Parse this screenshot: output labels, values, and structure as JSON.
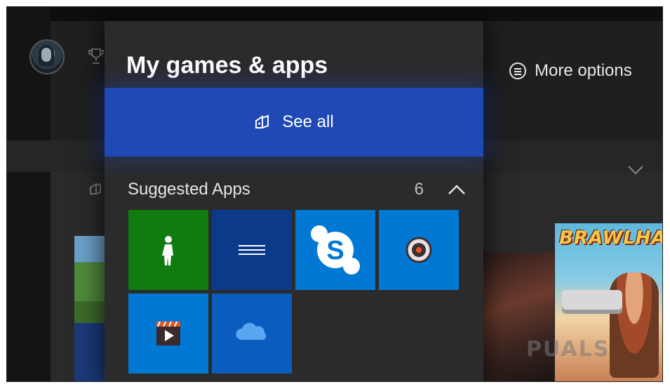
{
  "guide": {
    "title": "My games & apps",
    "see_all": {
      "label": "See all",
      "icon": "my-games-icon"
    },
    "section": {
      "label": "Suggested Apps",
      "count": "6",
      "toggle_icon": "chevron-up-icon"
    },
    "tiles": [
      {
        "app": "Avatar Editor",
        "icon": "avatar-figure-icon",
        "color": "#107c10"
      },
      {
        "app": "Menu app",
        "icon": "lines-icon",
        "color": "#0b3a8a"
      },
      {
        "app": "Skype",
        "icon": "skype-icon",
        "color": "#0078d4"
      },
      {
        "app": "Groove Music",
        "icon": "music-disc-icon",
        "color": "#0078d4"
      },
      {
        "app": "Movies & TV",
        "icon": "film-clapper-icon",
        "color": "#0078d4"
      },
      {
        "app": "OneDrive",
        "icon": "cloud-icon",
        "color": "#0b5cbf"
      }
    ]
  },
  "header": {
    "more_options": "More options",
    "more_options_icon": "menu-circle-icon"
  },
  "background": {
    "game_tile_title": "BRAWLHA",
    "watermark": "PUALS"
  },
  "colors": {
    "accent": "#1f49b4",
    "panel": "#2b2b2b",
    "xbox_green": "#107c10"
  }
}
